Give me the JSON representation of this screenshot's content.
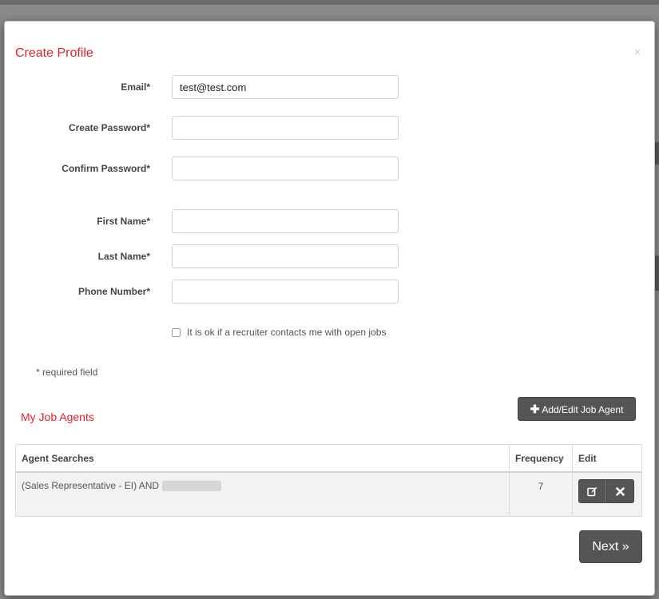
{
  "modal": {
    "title": "Create Profile",
    "close_symbol": "×"
  },
  "form": {
    "email": {
      "label": "Email*",
      "value": "test@test.com"
    },
    "create_password": {
      "label": "Create Password*",
      "value": ""
    },
    "confirm_password": {
      "label": "Confirm Password*",
      "value": ""
    },
    "first_name": {
      "label": "First Name*",
      "value": ""
    },
    "last_name": {
      "label": "Last Name*",
      "value": ""
    },
    "phone_number": {
      "label": "Phone Number*",
      "value": ""
    },
    "recruiter_checkbox": {
      "label": "It is ok if a recruiter contacts me with open jobs",
      "checked": false
    },
    "required_note": "* required field"
  },
  "job_agents": {
    "title": "My Job Agents",
    "add_button_label": "Add/Edit Job Agent",
    "add_button_icon": "plus-icon",
    "columns": [
      "Agent Searches",
      "Frequency",
      "Edit"
    ],
    "rows": [
      {
        "search": "(Sales Representative - EI) AND",
        "frequency": "7"
      }
    ],
    "edit_icons": [
      "edit-icon",
      "delete-icon"
    ]
  },
  "footer": {
    "next_label": "Next »"
  },
  "colors": {
    "accent": "#e4202b",
    "button": "#555555"
  }
}
